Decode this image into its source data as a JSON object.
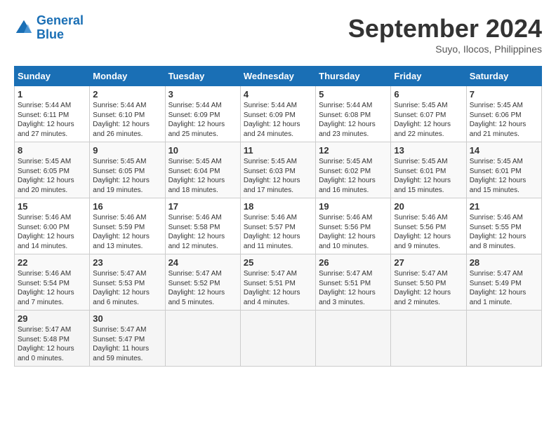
{
  "header": {
    "logo_line1": "General",
    "logo_line2": "Blue",
    "title": "September 2024",
    "subtitle": "Suyo, Ilocos, Philippines"
  },
  "days_of_week": [
    "Sunday",
    "Monday",
    "Tuesday",
    "Wednesday",
    "Thursday",
    "Friday",
    "Saturday"
  ],
  "weeks": [
    [
      {
        "day": "1",
        "sunrise": "5:44 AM",
        "sunset": "6:11 PM",
        "daylight": "12 hours and 27 minutes."
      },
      {
        "day": "2",
        "sunrise": "5:44 AM",
        "sunset": "6:10 PM",
        "daylight": "12 hours and 26 minutes."
      },
      {
        "day": "3",
        "sunrise": "5:44 AM",
        "sunset": "6:09 PM",
        "daylight": "12 hours and 25 minutes."
      },
      {
        "day": "4",
        "sunrise": "5:44 AM",
        "sunset": "6:09 PM",
        "daylight": "12 hours and 24 minutes."
      },
      {
        "day": "5",
        "sunrise": "5:44 AM",
        "sunset": "6:08 PM",
        "daylight": "12 hours and 23 minutes."
      },
      {
        "day": "6",
        "sunrise": "5:45 AM",
        "sunset": "6:07 PM",
        "daylight": "12 hours and 22 minutes."
      },
      {
        "day": "7",
        "sunrise": "5:45 AM",
        "sunset": "6:06 PM",
        "daylight": "12 hours and 21 minutes."
      }
    ],
    [
      {
        "day": "8",
        "sunrise": "5:45 AM",
        "sunset": "6:05 PM",
        "daylight": "12 hours and 20 minutes."
      },
      {
        "day": "9",
        "sunrise": "5:45 AM",
        "sunset": "6:05 PM",
        "daylight": "12 hours and 19 minutes."
      },
      {
        "day": "10",
        "sunrise": "5:45 AM",
        "sunset": "6:04 PM",
        "daylight": "12 hours and 18 minutes."
      },
      {
        "day": "11",
        "sunrise": "5:45 AM",
        "sunset": "6:03 PM",
        "daylight": "12 hours and 17 minutes."
      },
      {
        "day": "12",
        "sunrise": "5:45 AM",
        "sunset": "6:02 PM",
        "daylight": "12 hours and 16 minutes."
      },
      {
        "day": "13",
        "sunrise": "5:45 AM",
        "sunset": "6:01 PM",
        "daylight": "12 hours and 15 minutes."
      },
      {
        "day": "14",
        "sunrise": "5:45 AM",
        "sunset": "6:01 PM",
        "daylight": "12 hours and 15 minutes."
      }
    ],
    [
      {
        "day": "15",
        "sunrise": "5:46 AM",
        "sunset": "6:00 PM",
        "daylight": "12 hours and 14 minutes."
      },
      {
        "day": "16",
        "sunrise": "5:46 AM",
        "sunset": "5:59 PM",
        "daylight": "12 hours and 13 minutes."
      },
      {
        "day": "17",
        "sunrise": "5:46 AM",
        "sunset": "5:58 PM",
        "daylight": "12 hours and 12 minutes."
      },
      {
        "day": "18",
        "sunrise": "5:46 AM",
        "sunset": "5:57 PM",
        "daylight": "12 hours and 11 minutes."
      },
      {
        "day": "19",
        "sunrise": "5:46 AM",
        "sunset": "5:56 PM",
        "daylight": "12 hours and 10 minutes."
      },
      {
        "day": "20",
        "sunrise": "5:46 AM",
        "sunset": "5:56 PM",
        "daylight": "12 hours and 9 minutes."
      },
      {
        "day": "21",
        "sunrise": "5:46 AM",
        "sunset": "5:55 PM",
        "daylight": "12 hours and 8 minutes."
      }
    ],
    [
      {
        "day": "22",
        "sunrise": "5:46 AM",
        "sunset": "5:54 PM",
        "daylight": "12 hours and 7 minutes."
      },
      {
        "day": "23",
        "sunrise": "5:47 AM",
        "sunset": "5:53 PM",
        "daylight": "12 hours and 6 minutes."
      },
      {
        "day": "24",
        "sunrise": "5:47 AM",
        "sunset": "5:52 PM",
        "daylight": "12 hours and 5 minutes."
      },
      {
        "day": "25",
        "sunrise": "5:47 AM",
        "sunset": "5:51 PM",
        "daylight": "12 hours and 4 minutes."
      },
      {
        "day": "26",
        "sunrise": "5:47 AM",
        "sunset": "5:51 PM",
        "daylight": "12 hours and 3 minutes."
      },
      {
        "day": "27",
        "sunrise": "5:47 AM",
        "sunset": "5:50 PM",
        "daylight": "12 hours and 2 minutes."
      },
      {
        "day": "28",
        "sunrise": "5:47 AM",
        "sunset": "5:49 PM",
        "daylight": "12 hours and 1 minute."
      }
    ],
    [
      {
        "day": "29",
        "sunrise": "5:47 AM",
        "sunset": "5:48 PM",
        "daylight": "12 hours and 0 minutes."
      },
      {
        "day": "30",
        "sunrise": "5:47 AM",
        "sunset": "5:47 PM",
        "daylight": "11 hours and 59 minutes."
      },
      null,
      null,
      null,
      null,
      null
    ]
  ]
}
